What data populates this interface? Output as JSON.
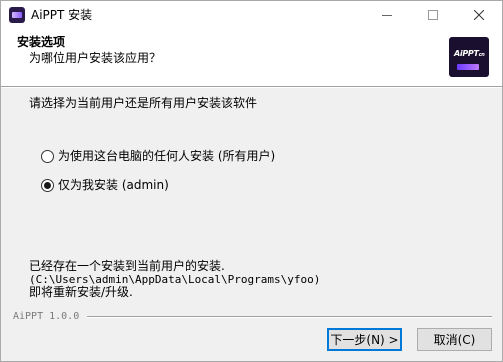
{
  "window": {
    "title": "AiPPT 安装",
    "icon": "aippt-app-icon"
  },
  "header": {
    "title": "安装选项",
    "subtitle": "为哪位用户安装该应用？",
    "logo_text": "AiPPT",
    "logo_suffix": "cn"
  },
  "body": {
    "prompt": "请选择为当前用户还是所有用户安装该软件",
    "options": [
      {
        "label": "为使用这台电脑的任何人安装 (所有用户)",
        "selected": false
      },
      {
        "label": "仅为我安装 (admin)",
        "selected": true
      }
    ],
    "note_line1": "已经存在一个安装到当前用户的安装.",
    "note_line2": "(C:\\Users\\admin\\AppData\\Local\\Programs\\yfoo)",
    "note_line3": "即将重新安装/升级."
  },
  "footer": {
    "brand": "AiPPT 1.0.0",
    "next_label": "下一步(N) >",
    "cancel_label": "取消(C)"
  }
}
